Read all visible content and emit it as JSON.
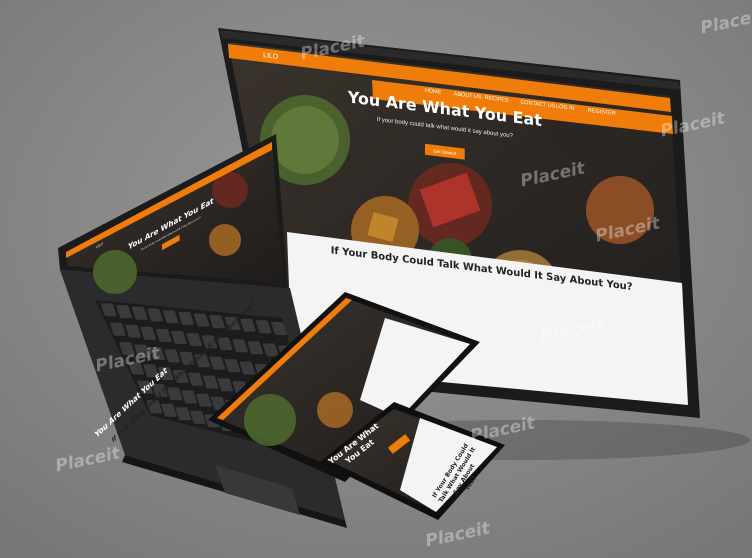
{
  "brand": "LILO",
  "nav": [
    "HOME",
    "ABOUT US",
    "RECIPES",
    "CONTACT US",
    "LOG IN",
    "REGISTER"
  ],
  "hero": {
    "title": "You Are What You Eat",
    "subtitle": "If your body could talk what would it say about you?",
    "button": "Get Started"
  },
  "section_heading": "If Your Body Could Talk What Would It Say About You?",
  "phone_hero_lines": [
    "You Are What",
    "You Eat"
  ],
  "phone_section_lines": [
    "If Your Body Could",
    "Talk What Would It",
    "Say About",
    "You?"
  ],
  "watermark": "Placeit",
  "colors": {
    "background": "#8a8a8a",
    "accent": "#f07d0a",
    "device_frame": "#1c1c1c",
    "hero_bg": "#2e2a27",
    "light_section": "#f4f4f4"
  }
}
